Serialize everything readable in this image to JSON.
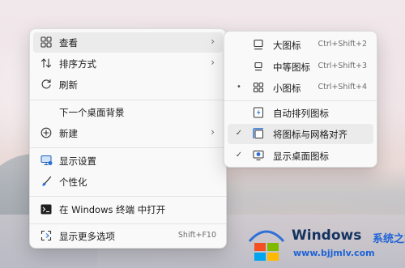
{
  "main_menu": {
    "items": [
      {
        "label": "查看",
        "icon": "view-grid-icon"
      },
      {
        "label": "排序方式",
        "icon": "sort-icon"
      },
      {
        "label": "刷新",
        "icon": "refresh-icon"
      },
      {
        "label": "下一个桌面背景",
        "icon": ""
      },
      {
        "label": "新建",
        "icon": "plus-circle-icon"
      },
      {
        "label": "显示设置",
        "icon": "display-icon"
      },
      {
        "label": "个性化",
        "icon": "brush-icon"
      },
      {
        "label": "在 Windows 终端 中打开",
        "icon": "terminal-icon"
      },
      {
        "label": "显示更多选项",
        "icon": "more-options-icon",
        "shortcut": "Shift+F10"
      }
    ]
  },
  "view_submenu": {
    "items": [
      {
        "label": "大图标",
        "shortcut": "Ctrl+Shift+2",
        "icon": "large-icon-icon",
        "state": ""
      },
      {
        "label": "中等图标",
        "shortcut": "Ctrl+Shift+3",
        "icon": "medium-icon-icon",
        "state": ""
      },
      {
        "label": "小图标",
        "shortcut": "Ctrl+Shift+4",
        "icon": "small-icons-icon",
        "state": "•"
      },
      {
        "label": "自动排列图标",
        "icon": "auto-arrange-icon",
        "state": ""
      },
      {
        "label": "将图标与网格对齐",
        "icon": "align-grid-icon",
        "state": "✓"
      },
      {
        "label": "显示桌面图标",
        "icon": "show-desktop-icons-icon",
        "state": "✓"
      }
    ]
  },
  "watermark": {
    "brand": "Windows",
    "suffix": "系统之家",
    "url": "www.bjjmlv.com"
  },
  "colors": {
    "menu_bg": "#f9f9f9",
    "hover_bg": "#ebebeb",
    "accent_blue": "#1e63d6"
  }
}
